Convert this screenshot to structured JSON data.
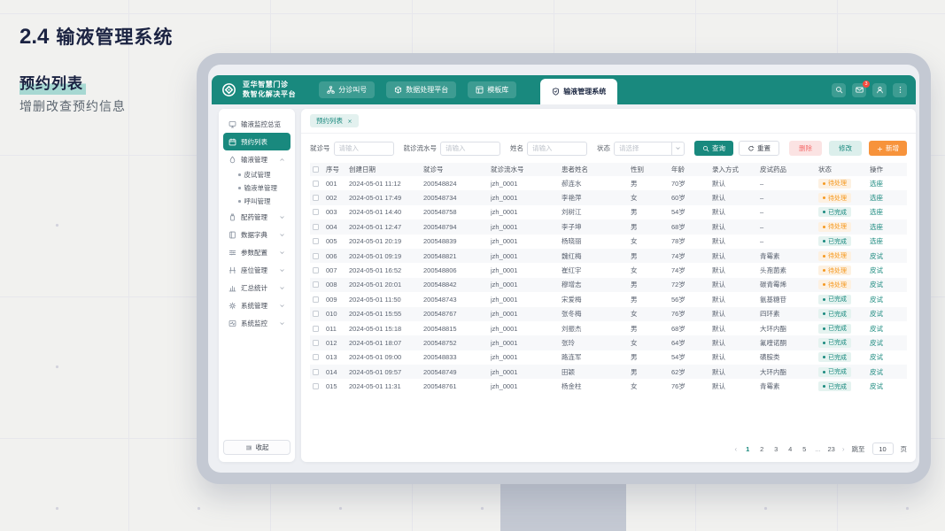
{
  "slide": {
    "section_number": "2.4",
    "section_title": "输液管理系统",
    "subtitle": "预约列表",
    "description": "增删改查预约信息"
  },
  "colors": {
    "primary": "#19897E",
    "orange": "#F7933B",
    "pending": "#F59A23",
    "done": "#19897E",
    "danger": "#F56C6C",
    "badge_red": "#F5493D",
    "monitor_frame": "#C4C9D3"
  },
  "app": {
    "brand": {
      "line1": "亚华智慧门诊",
      "line2": "数智化解决平台"
    },
    "nav": [
      {
        "name": "triage-call",
        "label": "分诊叫号",
        "icon": "sitemap-icon",
        "active": false
      },
      {
        "name": "data-platform",
        "label": "数据处理平台",
        "icon": "cube-icon",
        "active": false
      },
      {
        "name": "template-library",
        "label": "模板库",
        "icon": "template-icon",
        "active": false
      },
      {
        "name": "infusion-system",
        "label": "输液管理系统",
        "icon": "shield-icon",
        "active": true
      }
    ],
    "header_icons": [
      {
        "name": "search-button",
        "icon": "search-icon",
        "badge": ""
      },
      {
        "name": "messages-button",
        "icon": "mail-icon",
        "badge": "3"
      },
      {
        "name": "account-button",
        "icon": "user-icon",
        "badge": ""
      },
      {
        "name": "more-button",
        "icon": "more-icon",
        "badge": ""
      }
    ]
  },
  "sidebar": {
    "items": [
      {
        "name": "infusion-monitor-overview",
        "label": "输液监控总览",
        "icon": "monitor-icon",
        "active": false,
        "collapsible": false,
        "expanded": false,
        "children": []
      },
      {
        "name": "appointment-list",
        "label": "预约列表",
        "icon": "calendar-icon",
        "active": true,
        "collapsible": false,
        "expanded": false,
        "children": []
      },
      {
        "name": "infusion-management",
        "label": "输液管理",
        "icon": "drop-icon",
        "active": false,
        "collapsible": true,
        "expanded": true,
        "children": [
          {
            "name": "skin-test-management",
            "label": "皮试管理"
          },
          {
            "name": "infusion-order-management",
            "label": "输液单管理"
          },
          {
            "name": "call-management",
            "label": "呼叫管理"
          }
        ]
      },
      {
        "name": "dispensing-management",
        "label": "配药管理",
        "icon": "bottle-icon",
        "active": false,
        "collapsible": true,
        "expanded": false,
        "children": []
      },
      {
        "name": "data-dictionary",
        "label": "数据字典",
        "icon": "book-icon",
        "active": false,
        "collapsible": true,
        "expanded": false,
        "children": []
      },
      {
        "name": "parameter-config",
        "label": "参数配置",
        "icon": "sliders-icon",
        "active": false,
        "collapsible": true,
        "expanded": false,
        "children": []
      },
      {
        "name": "seat-management",
        "label": "座位管理",
        "icon": "seat-icon",
        "active": false,
        "collapsible": true,
        "expanded": false,
        "children": []
      },
      {
        "name": "summary-statistics",
        "label": "汇总统计",
        "icon": "chart-icon",
        "active": false,
        "collapsible": true,
        "expanded": false,
        "children": []
      },
      {
        "name": "system-management",
        "label": "系统管理",
        "icon": "gear-icon",
        "active": false,
        "collapsible": true,
        "expanded": false,
        "children": []
      },
      {
        "name": "system-monitor",
        "label": "系统监控",
        "icon": "pulse-icon",
        "active": false,
        "collapsible": true,
        "expanded": false,
        "children": []
      }
    ],
    "collapse_label": "收起"
  },
  "main": {
    "tab": {
      "label": "预约列表"
    },
    "filters": [
      {
        "name": "visit-no",
        "label": "就诊号",
        "placeholder": "请输入",
        "type": "input"
      },
      {
        "name": "visit-flow-no",
        "label": "就诊流水号",
        "placeholder": "请输入",
        "type": "input"
      },
      {
        "name": "patient-name",
        "label": "姓名",
        "placeholder": "请输入",
        "type": "input"
      },
      {
        "name": "status",
        "label": "状态",
        "placeholder": "请选择",
        "type": "select"
      }
    ],
    "search_label": "查询",
    "reset_label": "重置",
    "actions": {
      "delete": "删除",
      "edit": "修改",
      "add": "新增"
    }
  },
  "table": {
    "columns": [
      "序号",
      "创建日期",
      "就诊号",
      "就诊流水号",
      "患者姓名",
      "性别",
      "年龄",
      "录入方式",
      "皮试药品",
      "状态",
      "操作"
    ],
    "status_labels": {
      "pending": "待处理",
      "done": "已完成"
    },
    "rows": [
      {
        "seq": "001",
        "date": "2024-05-01 11:12",
        "visit_no": "200548824",
        "flow_no": "jzh_0001",
        "name": "郝连水",
        "gender": "男",
        "age": "70岁",
        "entry": "默认",
        "drug": "–",
        "status": "待处理",
        "status_type": "pending",
        "action": "选座"
      },
      {
        "seq": "002",
        "date": "2024-05-01 17:49",
        "visit_no": "200548734",
        "flow_no": "jzh_0001",
        "name": "李艳萍",
        "gender": "女",
        "age": "60岁",
        "entry": "默认",
        "drug": "–",
        "status": "待处理",
        "status_type": "pending",
        "action": "选座"
      },
      {
        "seq": "003",
        "date": "2024-05-01 14:40",
        "visit_no": "200548758",
        "flow_no": "jzh_0001",
        "name": "刘树江",
        "gender": "男",
        "age": "54岁",
        "entry": "默认",
        "drug": "–",
        "status": "已完成",
        "status_type": "done",
        "action": "选座"
      },
      {
        "seq": "004",
        "date": "2024-05-01 12:47",
        "visit_no": "200548794",
        "flow_no": "jzh_0001",
        "name": "李子坤",
        "gender": "男",
        "age": "68岁",
        "entry": "默认",
        "drug": "–",
        "status": "待处理",
        "status_type": "pending",
        "action": "选座"
      },
      {
        "seq": "005",
        "date": "2024-05-01 20:19",
        "visit_no": "200548839",
        "flow_no": "jzh_0001",
        "name": "杨晓丽",
        "gender": "女",
        "age": "78岁",
        "entry": "默认",
        "drug": "–",
        "status": "已完成",
        "status_type": "done",
        "action": "选座"
      },
      {
        "seq": "006",
        "date": "2024-05-01 09:19",
        "visit_no": "200548821",
        "flow_no": "jzh_0001",
        "name": "魏红梅",
        "gender": "男",
        "age": "74岁",
        "entry": "默认",
        "drug": "青霉素",
        "status": "待处理",
        "status_type": "pending",
        "action": "皮试"
      },
      {
        "seq": "007",
        "date": "2024-05-01 16:52",
        "visit_no": "200548806",
        "flow_no": "jzh_0001",
        "name": "崔红宇",
        "gender": "女",
        "age": "74岁",
        "entry": "默认",
        "drug": "头孢菌素",
        "status": "待处理",
        "status_type": "pending",
        "action": "皮试"
      },
      {
        "seq": "008",
        "date": "2024-05-01 20:01",
        "visit_no": "200548842",
        "flow_no": "jzh_0001",
        "name": "穆增志",
        "gender": "男",
        "age": "72岁",
        "entry": "默认",
        "drug": "碳青霉烯",
        "status": "待处理",
        "status_type": "pending",
        "action": "皮试"
      },
      {
        "seq": "009",
        "date": "2024-05-01 11:50",
        "visit_no": "200548743",
        "flow_no": "jzh_0001",
        "name": "宋爱梅",
        "gender": "男",
        "age": "56岁",
        "entry": "默认",
        "drug": "氨基糖苷",
        "status": "已完成",
        "status_type": "done",
        "action": "皮试"
      },
      {
        "seq": "010",
        "date": "2024-05-01 15:55",
        "visit_no": "200548767",
        "flow_no": "jzh_0001",
        "name": "张冬梅",
        "gender": "女",
        "age": "76岁",
        "entry": "默认",
        "drug": "四环素",
        "status": "已完成",
        "status_type": "done",
        "action": "皮试"
      },
      {
        "seq": "011",
        "date": "2024-05-01 15:18",
        "visit_no": "200548815",
        "flow_no": "jzh_0001",
        "name": "刘振杰",
        "gender": "男",
        "age": "68岁",
        "entry": "默认",
        "drug": "大环内酯",
        "status": "已完成",
        "status_type": "done",
        "action": "皮试"
      },
      {
        "seq": "012",
        "date": "2024-05-01 18:07",
        "visit_no": "200548752",
        "flow_no": "jzh_0001",
        "name": "张玲",
        "gender": "女",
        "age": "64岁",
        "entry": "默认",
        "drug": "氟喹诺酮",
        "status": "已完成",
        "status_type": "done",
        "action": "皮试"
      },
      {
        "seq": "013",
        "date": "2024-05-01 09:00",
        "visit_no": "200548833",
        "flow_no": "jzh_0001",
        "name": "路连军",
        "gender": "男",
        "age": "54岁",
        "entry": "默认",
        "drug": "磺胺类",
        "status": "已完成",
        "status_type": "done",
        "action": "皮试"
      },
      {
        "seq": "014",
        "date": "2024-05-01 09:57",
        "visit_no": "200548749",
        "flow_no": "jzh_0001",
        "name": "田颖",
        "gender": "男",
        "age": "62岁",
        "entry": "默认",
        "drug": "大环内酯",
        "status": "已完成",
        "status_type": "done",
        "action": "皮试"
      },
      {
        "seq": "015",
        "date": "2024-05-01 11:31",
        "visit_no": "200548761",
        "flow_no": "jzh_0001",
        "name": "杨金柱",
        "gender": "女",
        "age": "76岁",
        "entry": "默认",
        "drug": "青霉素",
        "status": "已完成",
        "status_type": "done",
        "action": "皮试"
      }
    ]
  },
  "pagination": {
    "pages": [
      "1",
      "2",
      "3",
      "4",
      "5",
      "...",
      "23"
    ],
    "active": "1",
    "prev": "‹",
    "next": "›",
    "jump_label": "跳至",
    "jump_value": "10",
    "page_label": "页"
  }
}
